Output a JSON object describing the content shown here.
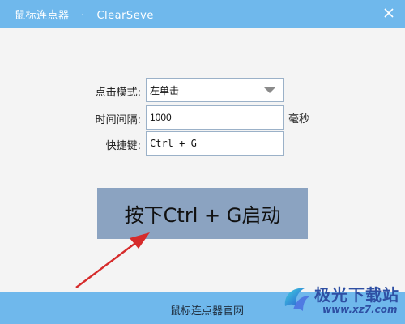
{
  "window": {
    "title": "鼠标连点器",
    "subtitle": "ClearSeve",
    "separator": "·"
  },
  "form": {
    "click_mode": {
      "label": "点击模式:",
      "value": "左单击"
    },
    "interval": {
      "label": "时间间隔:",
      "value": "1000",
      "unit": "毫秒"
    },
    "hotkey": {
      "label": "快捷键:",
      "value": "Ctrl + G"
    }
  },
  "start_button": {
    "label": "按下Ctrl + G启动"
  },
  "footer": {
    "link": "鼠标连点器官网"
  },
  "watermark": {
    "name": "极光下载站",
    "url": "www.xz7.com"
  },
  "colors": {
    "titlebar": "#6fb8ec",
    "footer": "#6fb8ec",
    "start_button": "#8ba3c1",
    "annotation_arrow": "#d62b2b"
  },
  "icons": {
    "close": "close-icon",
    "dropdown": "chevron-down-icon",
    "watermark_logo": "aurora-logo-icon"
  }
}
